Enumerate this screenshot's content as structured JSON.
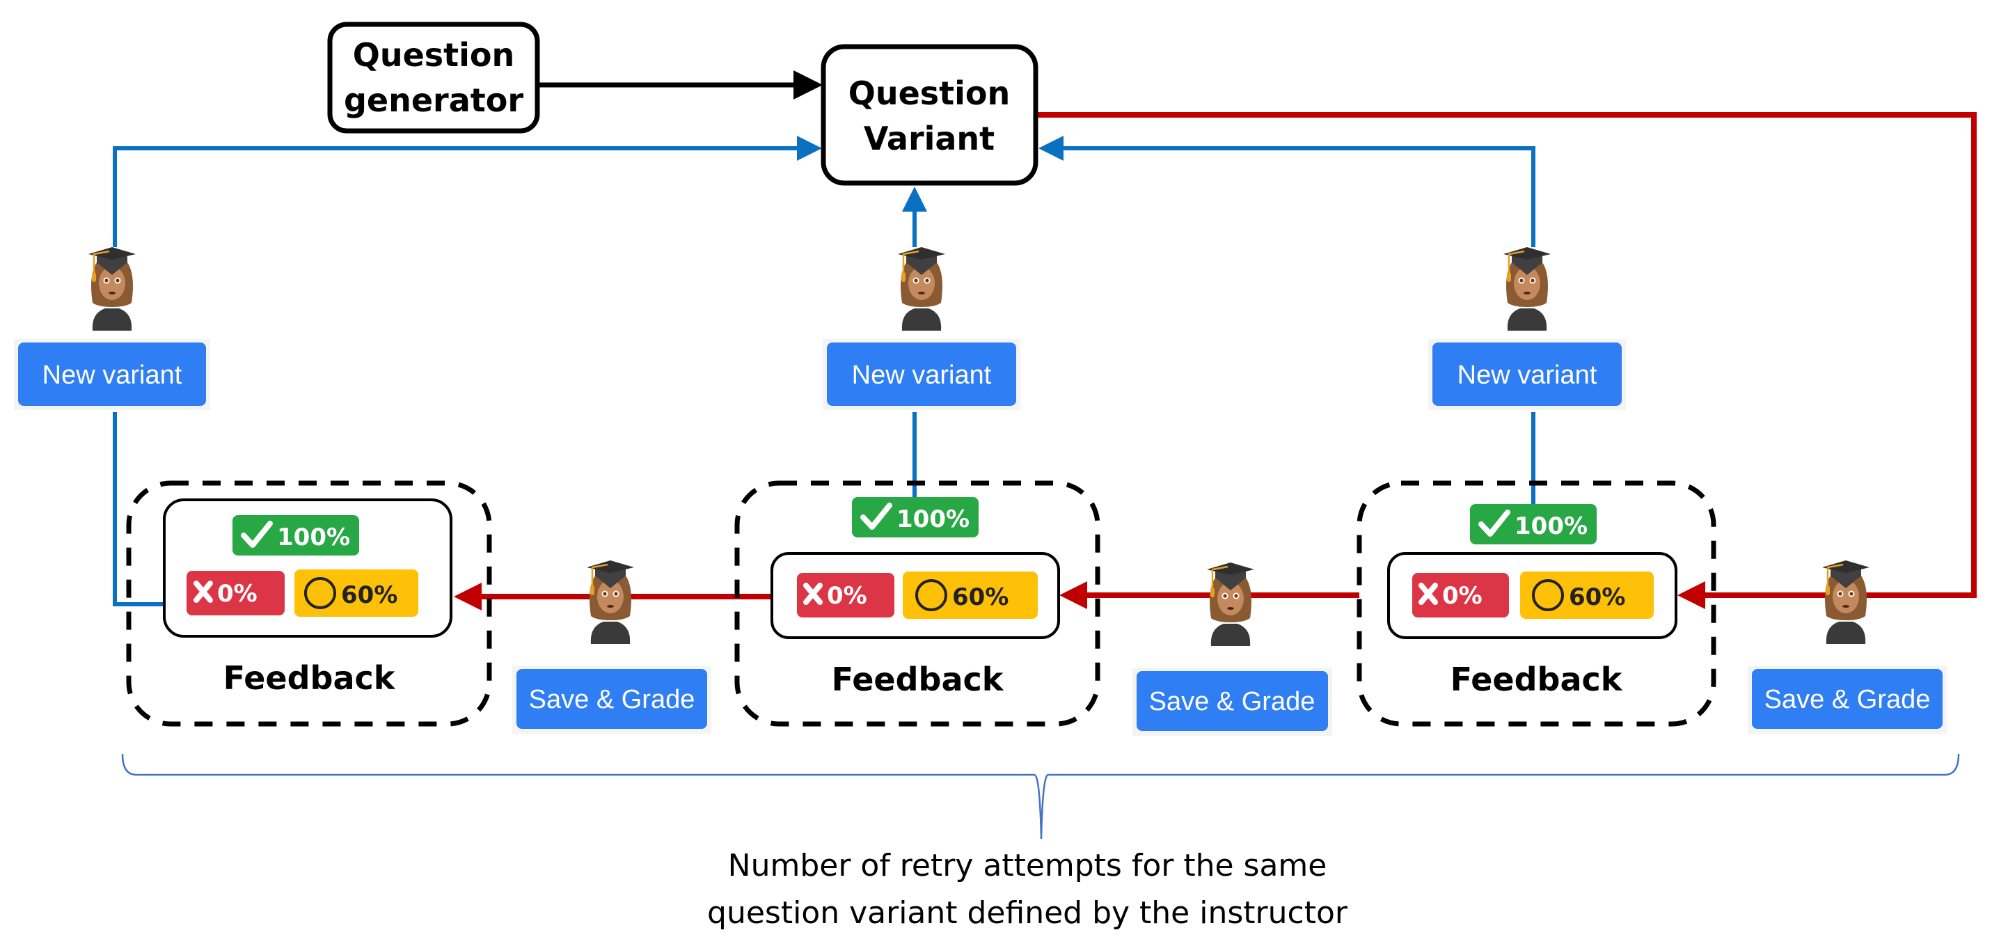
{
  "colors": {
    "flow_black": "#000000",
    "new_variant_line": "#0a70c2",
    "retry_line": "#c00000",
    "button_blue": "#2f7ef3",
    "correct_green": "#28a745",
    "wrong_red": "#dc3545",
    "partial_yellow": "#ffc107",
    "brace_blue": "#4472c4"
  },
  "nodes": {
    "question_generator": {
      "line1": "Question",
      "line2": "generator"
    },
    "question_variant": {
      "line1": "Question",
      "line2": "Variant"
    }
  },
  "new_variant_buttons": [
    {
      "label": "New variant",
      "avatar": "student-graduate-icon"
    },
    {
      "label": "New variant",
      "avatar": "student-graduate-icon"
    },
    {
      "label": "New variant",
      "avatar": "student-graduate-icon"
    }
  ],
  "save_grade_buttons": [
    {
      "label": "Save & Grade",
      "avatar": "student-graduate-icon"
    },
    {
      "label": "Save & Grade",
      "avatar": "student-graduate-icon"
    },
    {
      "label": "Save & Grade",
      "avatar": "student-graduate-icon"
    }
  ],
  "feedback_blocks": [
    {
      "label": "Feedback",
      "correct": {
        "icon": "check-icon",
        "text": "100%"
      },
      "wrong": {
        "icon": "x-icon",
        "text": "0%"
      },
      "partial": {
        "icon": "circle-icon",
        "text": "60%"
      }
    },
    {
      "label": "Feedback",
      "correct": {
        "icon": "check-icon",
        "text": "100%"
      },
      "wrong": {
        "icon": "x-icon",
        "text": "0%"
      },
      "partial": {
        "icon": "circle-icon",
        "text": "60%"
      }
    },
    {
      "label": "Feedback",
      "correct": {
        "icon": "check-icon",
        "text": "100%"
      },
      "wrong": {
        "icon": "x-icon",
        "text": "0%"
      },
      "partial": {
        "icon": "circle-icon",
        "text": "60%"
      }
    }
  ],
  "caption": {
    "line1": "Number of retry attempts for the same",
    "line2": "question variant defined by the instructor"
  }
}
